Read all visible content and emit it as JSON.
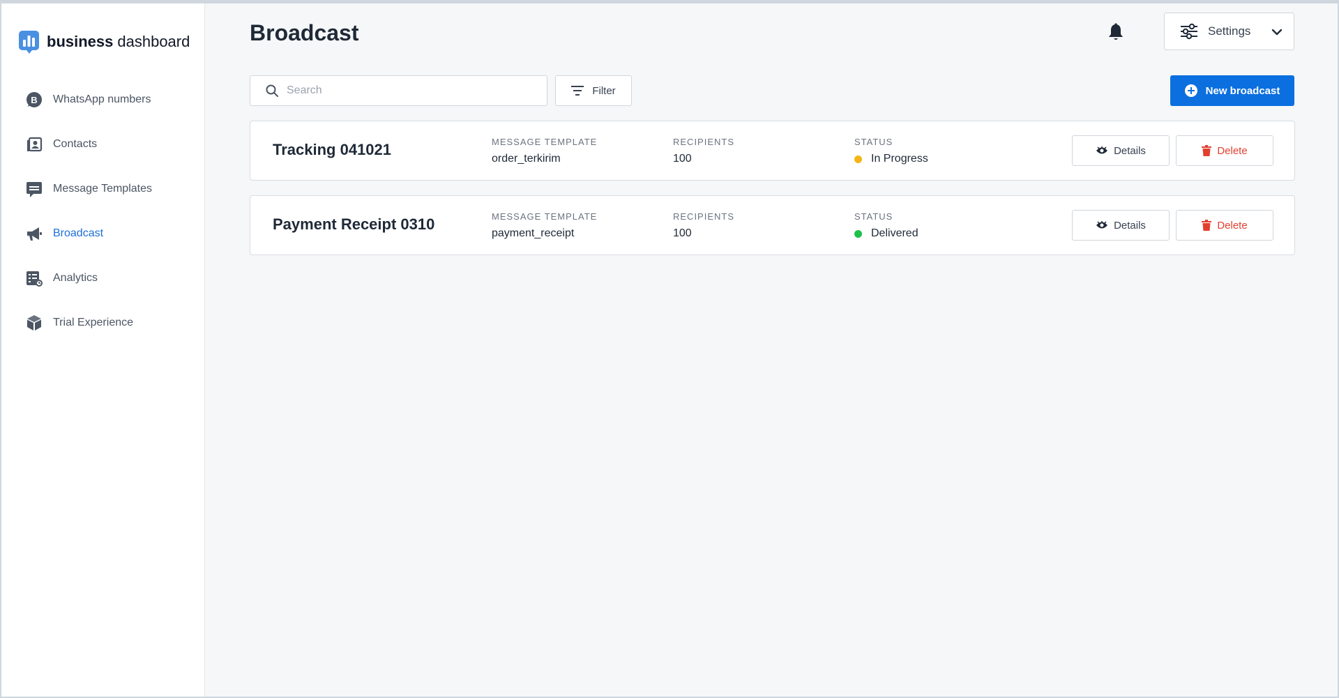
{
  "brand": {
    "name_bold": "business",
    "name_light": "dashboard"
  },
  "sidebar": {
    "items": [
      {
        "label": "WhatsApp numbers",
        "icon": "whatsapp-b-icon",
        "active": false
      },
      {
        "label": "Contacts",
        "icon": "contacts-icon",
        "active": false
      },
      {
        "label": "Message Templates",
        "icon": "message-template-icon",
        "active": false
      },
      {
        "label": "Broadcast",
        "icon": "megaphone-icon",
        "active": true
      },
      {
        "label": "Analytics",
        "icon": "analytics-icon",
        "active": false
      },
      {
        "label": "Trial Experience",
        "icon": "cube-icon",
        "active": false
      }
    ]
  },
  "header": {
    "title": "Broadcast",
    "settings_label": "Settings"
  },
  "toolbar": {
    "search_placeholder": "Search",
    "filter_label": "Filter",
    "new_broadcast_label": "New broadcast"
  },
  "columns": {
    "template": "MESSAGE TEMPLATE",
    "recipients": "RECIPIENTS",
    "status": "STATUS"
  },
  "broadcasts": [
    {
      "name": "Tracking 041021",
      "template": "order_terkirim",
      "recipients": "100",
      "status": "In Progress",
      "status_color": "#f5b515",
      "details_label": "Details",
      "delete_label": "Delete"
    },
    {
      "name": "Payment Receipt 0310",
      "template": "payment_receipt",
      "recipients": "100",
      "status": "Delivered",
      "status_color": "#1fbf4a",
      "details_label": "Details",
      "delete_label": "Delete"
    }
  ],
  "colors": {
    "accent": "#0b6fe0",
    "active_nav": "#1d6fd6",
    "danger": "#e2402f"
  }
}
